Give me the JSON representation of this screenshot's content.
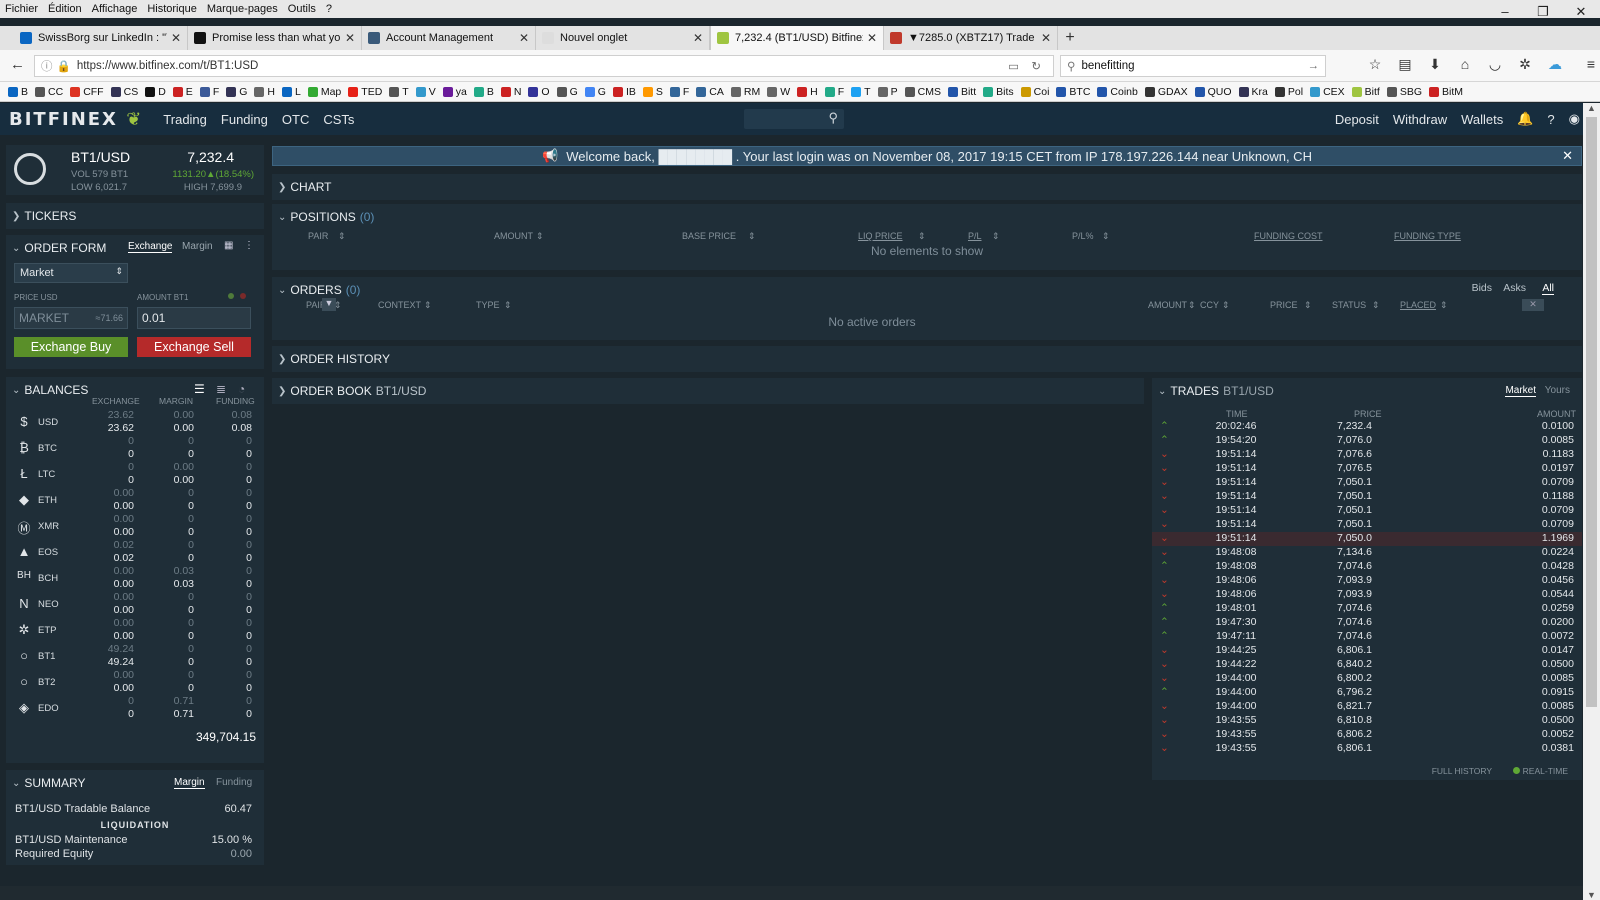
{
  "browser": {
    "menu": [
      "Fichier",
      "Édition",
      "Affichage",
      "Historique",
      "Marque-pages",
      "Outils",
      "?"
    ],
    "tabs": [
      {
        "title": "SwissBorg sur LinkedIn : \"Yo",
        "color": "#0a66c2"
      },
      {
        "title": "Promise less than what you",
        "color": "#111111"
      },
      {
        "title": "Account Management",
        "color": "#3a5a7a"
      },
      {
        "title": "Nouvel onglet",
        "color": "#dddddd"
      },
      {
        "title": "7,232.4 (BT1/USD) Bitfinex - Trad",
        "color": "#9fc541"
      },
      {
        "title": "▼7285.0 (XBTZ17) Trade - Bi",
        "color": "#c0392b"
      }
    ],
    "url": "https://www.bitfinex.com/t/BT1:USD",
    "search": "benefitting",
    "bookmarks": [
      {
        "label": "B",
        "color": "#0a66c2"
      },
      {
        "label": "CC",
        "color": "#555"
      },
      {
        "label": "CFF",
        "color": "#d32"
      },
      {
        "label": "CS",
        "color": "#335"
      },
      {
        "label": "D",
        "color": "#111"
      },
      {
        "label": "E",
        "color": "#c22"
      },
      {
        "label": "F",
        "color": "#3b5998"
      },
      {
        "label": "G",
        "color": "#335"
      },
      {
        "label": "H",
        "color": "#666"
      },
      {
        "label": "L",
        "color": "#0a66c2"
      },
      {
        "label": "Map",
        "color": "#3a3"
      },
      {
        "label": "TED",
        "color": "#e62117"
      },
      {
        "label": "T",
        "color": "#555"
      },
      {
        "label": "V",
        "color": "#39c"
      },
      {
        "label": "ya",
        "color": "#6a1b9a"
      },
      {
        "label": "B",
        "color": "#2a8"
      },
      {
        "label": "N",
        "color": "#c22"
      },
      {
        "label": "O",
        "color": "#339"
      },
      {
        "label": "G",
        "color": "#555"
      },
      {
        "label": "G",
        "color": "#4285f4"
      },
      {
        "label": "IB",
        "color": "#c22"
      },
      {
        "label": "S",
        "color": "#f90"
      },
      {
        "label": "F",
        "color": "#369"
      },
      {
        "label": "CA",
        "color": "#369"
      },
      {
        "label": "RM",
        "color": "#666"
      },
      {
        "label": "W",
        "color": "#666"
      },
      {
        "label": "H",
        "color": "#c22"
      },
      {
        "label": "F",
        "color": "#2a8"
      },
      {
        "label": "T",
        "color": "#1da1f2"
      },
      {
        "label": "P",
        "color": "#666"
      },
      {
        "label": "CMS",
        "color": "#555"
      },
      {
        "label": "Bitt",
        "color": "#2255aa"
      },
      {
        "label": "Bits",
        "color": "#2a8"
      },
      {
        "label": "Coi",
        "color": "#c90"
      },
      {
        "label": "BTC",
        "color": "#2255aa"
      },
      {
        "label": "Coinb",
        "color": "#2255aa"
      },
      {
        "label": "GDAX",
        "color": "#333"
      },
      {
        "label": "QUO",
        "color": "#2255aa"
      },
      {
        "label": "Kra",
        "color": "#335"
      },
      {
        "label": "Pol",
        "color": "#333"
      },
      {
        "label": "CEX",
        "color": "#39c"
      },
      {
        "label": "Bitf",
        "color": "#9fc541"
      },
      {
        "label": "SBG",
        "color": "#555"
      },
      {
        "label": "BitM",
        "color": "#c22"
      }
    ]
  },
  "app": {
    "logo": "BITFINEX",
    "nav": [
      "Trading",
      "Funding",
      "OTC",
      "CSTs"
    ],
    "right": [
      "Deposit",
      "Withdraw",
      "Wallets"
    ],
    "welcome": "Welcome back,  ████████ . Your last login was on November 08, 2017 19:15 CET from IP 178.197.226.144 near Unknown, CH"
  },
  "ticker": {
    "pair": "BT1/USD",
    "price": "7,232.4",
    "vol": "VOL 579 BT1",
    "change": "1131.20▲(18.54%)",
    "low": "LOW 6,021.7",
    "high": "HIGH 7,699.9"
  },
  "tickers": {
    "label": "TICKERS"
  },
  "order_form": {
    "label": "ORDER FORM",
    "tab_exchange": "Exchange",
    "tab_margin": "Margin",
    "type": "Market",
    "price_label": "PRICE USD",
    "amount_label": "AMOUNT BT1",
    "price_value": "MARKET",
    "price_hint": "≈71.66",
    "amount_value": "0.01",
    "buy": "Exchange Buy",
    "sell": "Exchange Sell"
  },
  "balances": {
    "label": "BALANCES",
    "headers": [
      "EXCHANGE",
      "MARGIN",
      "FUNDING"
    ],
    "rows": [
      {
        "cur": "USD",
        "icon": "$",
        "ex": [
          "23.62",
          "23.62"
        ],
        "mg": [
          "0.00",
          "0.00"
        ],
        "fd": [
          "0.08",
          "0.08"
        ]
      },
      {
        "cur": "BTC",
        "icon": "₿",
        "ex": [
          "0",
          "0"
        ],
        "mg": [
          "0",
          "0"
        ],
        "fd": [
          "0",
          "0"
        ]
      },
      {
        "cur": "LTC",
        "icon": "Ł",
        "ex": [
          "0",
          "0"
        ],
        "mg": [
          "0.00",
          "0.00"
        ],
        "fd": [
          "0",
          "0"
        ]
      },
      {
        "cur": "ETH",
        "icon": "◆",
        "ex": [
          "0.00",
          "0.00"
        ],
        "mg": [
          "0",
          "0"
        ],
        "fd": [
          "0",
          "0"
        ]
      },
      {
        "cur": "XMR",
        "icon": "Ⓜ",
        "ex": [
          "0.00",
          "0.00"
        ],
        "mg": [
          "0",
          "0"
        ],
        "fd": [
          "0",
          "0"
        ]
      },
      {
        "cur": "EOS",
        "icon": "▲",
        "ex": [
          "0.02",
          "0.02"
        ],
        "mg": [
          "0",
          "0"
        ],
        "fd": [
          "0",
          "0"
        ]
      },
      {
        "cur": "BCH",
        "icon": "BH",
        "ex": [
          "0.00",
          "0.00"
        ],
        "mg": [
          "0.03",
          "0.03"
        ],
        "fd": [
          "0",
          "0"
        ]
      },
      {
        "cur": "NEO",
        "icon": "N",
        "ex": [
          "0.00",
          "0.00"
        ],
        "mg": [
          "0",
          "0"
        ],
        "fd": [
          "0",
          "0"
        ]
      },
      {
        "cur": "ETP",
        "icon": "✲",
        "ex": [
          "0.00",
          "0.00"
        ],
        "mg": [
          "0",
          "0"
        ],
        "fd": [
          "0",
          "0"
        ]
      },
      {
        "cur": "BT1",
        "icon": "○",
        "ex": [
          "49.24",
          "49.24"
        ],
        "mg": [
          "0",
          "0"
        ],
        "fd": [
          "0",
          "0"
        ]
      },
      {
        "cur": "BT2",
        "icon": "○",
        "ex": [
          "0.00",
          "0.00"
        ],
        "mg": [
          "0",
          "0"
        ],
        "fd": [
          "0",
          "0"
        ]
      },
      {
        "cur": "EDO",
        "icon": "◈",
        "ex": [
          "0",
          "0"
        ],
        "mg": [
          "0.71",
          "0.71"
        ],
        "fd": [
          "0",
          "0"
        ]
      }
    ],
    "total": "349,704.15"
  },
  "summary": {
    "label": "SUMMARY",
    "tab_margin": "Margin",
    "tab_funding": "Funding",
    "tradable_label": "BT1/USD Tradable Balance",
    "tradable_value": "60.47",
    "liquidation": "LIQUIDATION",
    "maint_label": "BT1/USD Maintenance",
    "maint_value": "15.00 %",
    "equity_label": "Required Equity",
    "equity_value": "0.00"
  },
  "chart": {
    "label": "CHART"
  },
  "positions": {
    "label": "POSITIONS",
    "count": "(0)",
    "cols": [
      "PAIR",
      "AMOUNT",
      "BASE PRICE",
      "LIQ PRICE",
      "P/L",
      "P/L%",
      "FUNDING COST",
      "FUNDING TYPE"
    ],
    "empty": "No elements to show"
  },
  "orders": {
    "label": "ORDERS",
    "count": "(0)",
    "filters": [
      "Bids",
      "Asks",
      "All"
    ],
    "cols": [
      "PAIR",
      "CONTEXT",
      "TYPE",
      "AMOUNT",
      "CCY",
      "PRICE",
      "STATUS",
      "PLACED"
    ],
    "empty": "No active orders"
  },
  "order_history": {
    "label": "ORDER HISTORY"
  },
  "order_book": {
    "label": "ORDER BOOK",
    "pair": "BT1/USD"
  },
  "trades": {
    "label": "TRADES",
    "pair": "BT1/USD",
    "tab_market": "Market",
    "tab_yours": "Yours",
    "cols": [
      "TIME",
      "PRICE",
      "AMOUNT"
    ],
    "rows": [
      {
        "dir": "up",
        "time": "20:02:46",
        "price": "7,232.4",
        "amount": "0.0100"
      },
      {
        "dir": "up",
        "time": "19:54:20",
        "price": "7,076.0",
        "amount": "0.0085"
      },
      {
        "dir": "dn",
        "time": "19:51:14",
        "price": "7,076.6",
        "amount": "0.1183"
      },
      {
        "dir": "dn",
        "time": "19:51:14",
        "price": "7,076.5",
        "amount": "0.0197"
      },
      {
        "dir": "dn",
        "time": "19:51:14",
        "price": "7,050.1",
        "amount": "0.0709"
      },
      {
        "dir": "dn",
        "time": "19:51:14",
        "price": "7,050.1",
        "amount": "0.1188"
      },
      {
        "dir": "dn",
        "time": "19:51:14",
        "price": "7,050.1",
        "amount": "0.0709"
      },
      {
        "dir": "dn",
        "time": "19:51:14",
        "price": "7,050.1",
        "amount": "0.0709"
      },
      {
        "dir": "dn",
        "time": "19:51:14",
        "price": "7,050.0",
        "amount": "1.1969"
      },
      {
        "dir": "dn",
        "time": "19:48:08",
        "price": "7,134.6",
        "amount": "0.0224"
      },
      {
        "dir": "up",
        "time": "19:48:08",
        "price": "7,074.6",
        "amount": "0.0428"
      },
      {
        "dir": "dn",
        "time": "19:48:06",
        "price": "7,093.9",
        "amount": "0.0456"
      },
      {
        "dir": "dn",
        "time": "19:48:06",
        "price": "7,093.9",
        "amount": "0.0544"
      },
      {
        "dir": "up",
        "time": "19:48:01",
        "price": "7,074.6",
        "amount": "0.0259"
      },
      {
        "dir": "up",
        "time": "19:47:30",
        "price": "7,074.6",
        "amount": "0.0200"
      },
      {
        "dir": "up",
        "time": "19:47:11",
        "price": "7,074.6",
        "amount": "0.0072"
      },
      {
        "dir": "dn",
        "time": "19:44:25",
        "price": "6,806.1",
        "amount": "0.0147"
      },
      {
        "dir": "dn",
        "time": "19:44:22",
        "price": "6,840.2",
        "amount": "0.0500"
      },
      {
        "dir": "dn",
        "time": "19:44:00",
        "price": "6,800.2",
        "amount": "0.0085"
      },
      {
        "dir": "up",
        "time": "19:44:00",
        "price": "6,796.2",
        "amount": "0.0915"
      },
      {
        "dir": "dn",
        "time": "19:44:00",
        "price": "6,821.7",
        "amount": "0.0085"
      },
      {
        "dir": "dn",
        "time": "19:43:55",
        "price": "6,810.8",
        "amount": "0.0500"
      },
      {
        "dir": "dn",
        "time": "19:43:55",
        "price": "6,806.2",
        "amount": "0.0052"
      },
      {
        "dir": "dn",
        "time": "19:43:55",
        "price": "6,806.1",
        "amount": "0.0381"
      }
    ],
    "full_history": "FULL HISTORY",
    "realtime": "REAL-TIME"
  },
  "colors": {
    "accent": "#9fc541",
    "up": "#5fa835",
    "down": "#c0392b",
    "buy": "#5a8f29",
    "sell": "#b52a2a"
  }
}
